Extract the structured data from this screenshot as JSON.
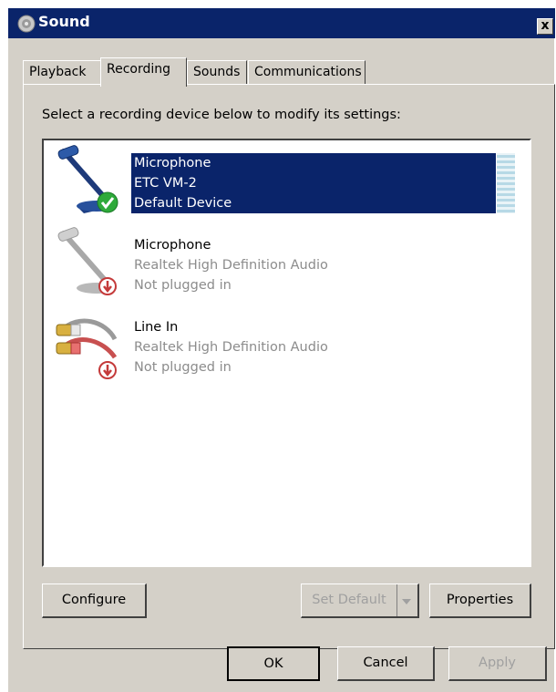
{
  "window": {
    "title": "Sound",
    "close_label": "x"
  },
  "tabs": [
    {
      "label": "Playback"
    },
    {
      "label": "Recording",
      "active": true
    },
    {
      "label": "Sounds"
    },
    {
      "label": "Communications"
    }
  ],
  "recording": {
    "instruction": "Select a recording device below to modify its settings:",
    "devices": [
      {
        "name": "Microphone",
        "description": "ETC VM-2",
        "status": "Default Device",
        "icon": "microphone-icon",
        "badge": "green-check-badge-icon",
        "selected": true
      },
      {
        "name": "Microphone",
        "description": "Realtek High Definition Audio",
        "status": "Not plugged in",
        "icon": "microphone-icon",
        "badge": "red-unplugged-badge-icon",
        "selected": false
      },
      {
        "name": "Line In",
        "description": "Realtek High Definition Audio",
        "status": "Not plugged in",
        "icon": "line-in-cable-icon",
        "badge": "red-unplugged-badge-icon",
        "selected": false
      }
    ],
    "buttons": {
      "configure": "Configure",
      "set_default": "Set Default",
      "properties": "Properties"
    }
  },
  "dialog_buttons": {
    "ok": "OK",
    "cancel": "Cancel",
    "apply": "Apply"
  },
  "colors": {
    "title_bar": "#0a246a",
    "selection": "#0a246a",
    "dialog_face": "#d4d0c8"
  }
}
